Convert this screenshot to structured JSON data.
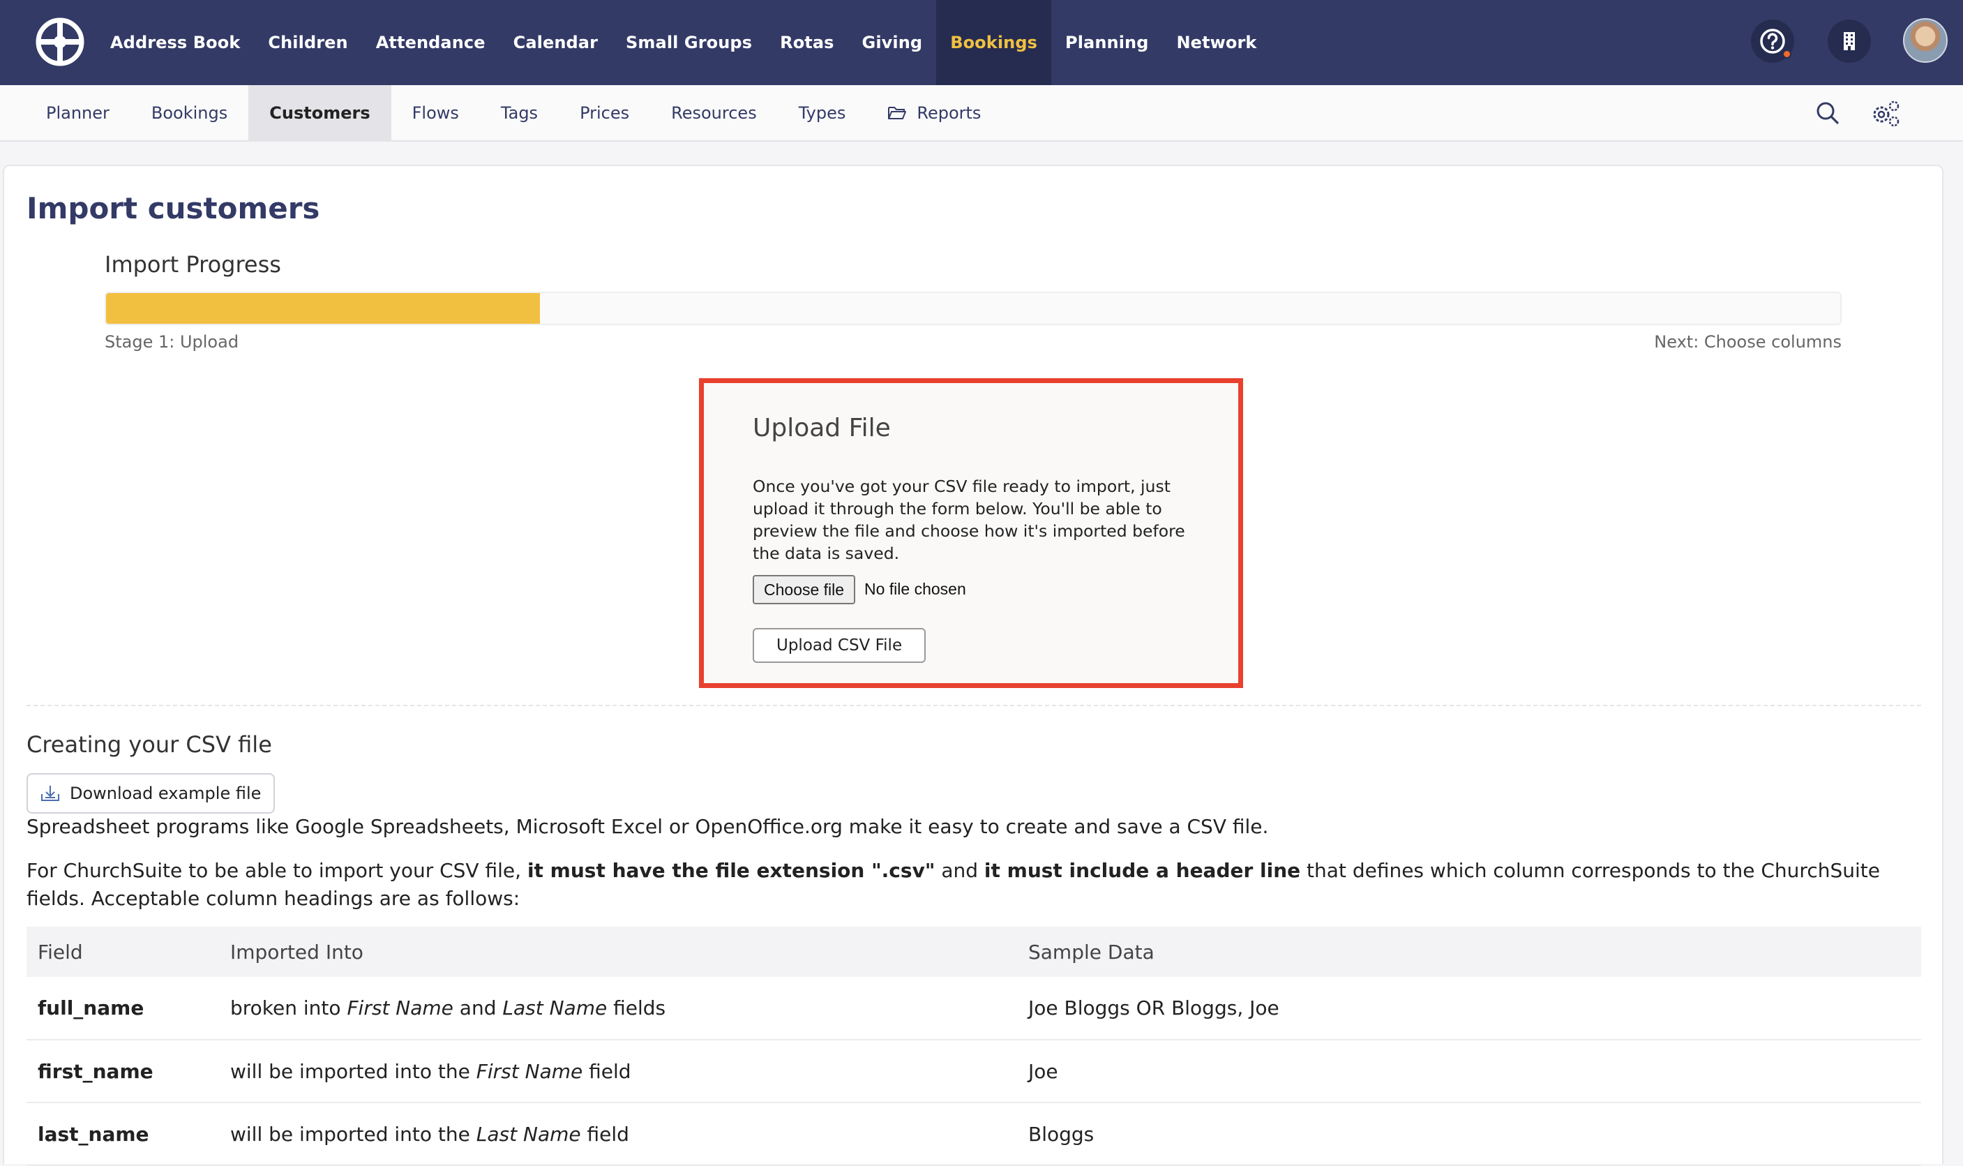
{
  "top_nav": {
    "items": [
      "Address Book",
      "Children",
      "Attendance",
      "Calendar",
      "Small Groups",
      "Rotas",
      "Giving",
      "Bookings",
      "Planning",
      "Network"
    ],
    "active": "Bookings",
    "icons": [
      "churchsuite-logo-icon",
      "help-icon",
      "building-icon",
      "user-avatar"
    ]
  },
  "sub_nav": {
    "items": [
      "Planner",
      "Bookings",
      "Customers",
      "Flows",
      "Tags",
      "Prices",
      "Resources",
      "Types",
      "Reports"
    ],
    "active": "Customers",
    "icons": [
      "folder-icon",
      "search-icon",
      "settings-gears-icon"
    ]
  },
  "page": {
    "title": "Import customers"
  },
  "progress": {
    "label": "Import Progress",
    "fraction": 0.25,
    "stage": "Stage 1: Upload",
    "next": "Next: Choose columns",
    "fill_color": "#f2c040"
  },
  "upload": {
    "title": "Upload File",
    "description": "Once you've got your CSV file ready to import, just upload it through the form below. You'll be able to preview the file and choose how it's imported before the data is saved.",
    "choose_label": "Choose file",
    "no_file_label": "No file chosen",
    "upload_label": "Upload CSV File",
    "highlight_color": "#e8412e"
  },
  "csv": {
    "title": "Creating your CSV file",
    "download_label": "Download example file",
    "para1": "Spreadsheet programs like Google Spreadsheets, Microsoft Excel or OpenOffice.org make it easy to create and save a CSV file.",
    "para2_a": "For ChurchSuite to be able to import your CSV file, ",
    "para2_b": "it must have the file extension \".csv\"",
    "para2_c": " and ",
    "para2_d": "it must include a header line",
    "para2_e": " that defines which column corresponds to the ChurchSuite fields. Acceptable column headings are as follows:"
  },
  "table": {
    "headers": [
      "Field",
      "Imported Into",
      "Sample Data"
    ],
    "rows": [
      {
        "field": "full_name",
        "into_pre": "broken into ",
        "into_em1": "First Name",
        "into_mid": " and ",
        "into_em2": "Last Name",
        "into_post": " fields",
        "sample": "Joe Bloggs OR Bloggs, Joe"
      },
      {
        "field": "first_name",
        "into_pre": "will be imported into the ",
        "into_em1": "First Name",
        "into_mid": " field",
        "into_em2": "",
        "into_post": "",
        "sample": "Joe"
      },
      {
        "field": "last_name",
        "into_pre": "will be imported into the ",
        "into_em1": "Last Name",
        "into_mid": " field",
        "into_em2": "",
        "into_post": "",
        "sample": "Bloggs"
      }
    ]
  },
  "colors": {
    "nav_bg": "#333a66",
    "nav_active_bg": "#262c50",
    "nav_active_text": "#f0c040",
    "title": "#333a66"
  }
}
